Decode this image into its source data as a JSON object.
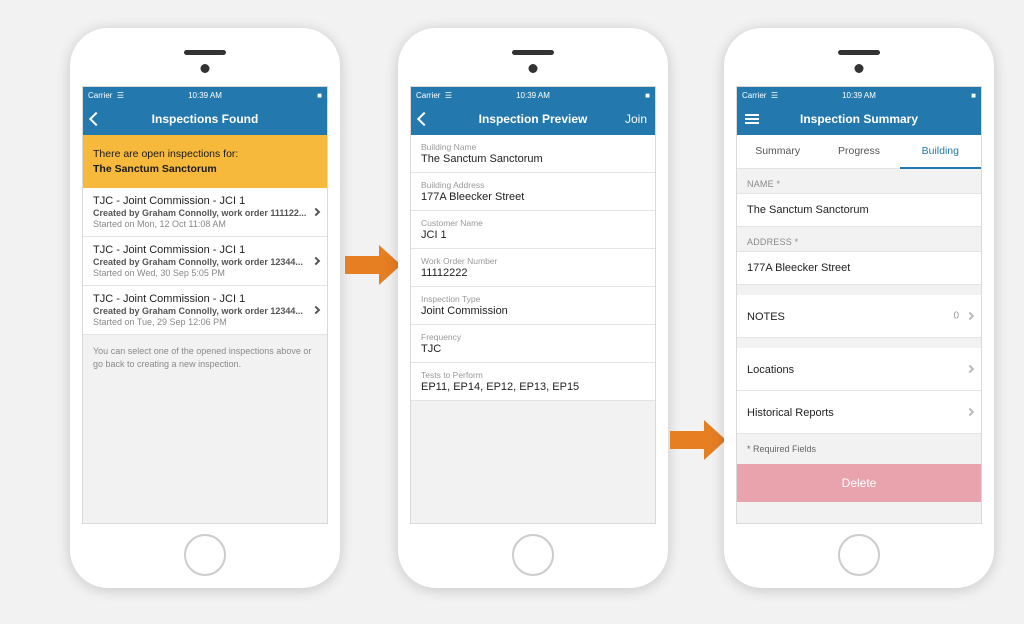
{
  "status": {
    "carrier": "Carrier",
    "wifi": "▴",
    "time": "10:39 AM",
    "battery": "■"
  },
  "phone1": {
    "nav_title": "Inspections Found",
    "banner_line1": "There are open inspections for:",
    "banner_line2": "The Sanctum Sanctorum",
    "items": [
      {
        "title": "TJC - Joint Commission - JCI 1",
        "sub": "Created by Graham Connolly, work order 111122...",
        "started": "Started on Mon, 12 Oct 11:08 AM"
      },
      {
        "title": "TJC - Joint Commission - JCI 1",
        "sub": "Created by Graham Connolly, work order 12344...",
        "started": "Started on Wed, 30 Sep 5:05 PM"
      },
      {
        "title": "TJC - Joint Commission - JCI 1",
        "sub": "Created by Graham Connolly, work order 12344...",
        "started": "Started on Tue, 29 Sep 12:06 PM"
      }
    ],
    "helper": "You can select one of the opened inspections above or go back to creating a new inspection."
  },
  "phone2": {
    "nav_title": "Inspection Preview",
    "join": "Join",
    "fields": [
      {
        "label": "Building Name",
        "value": "The Sanctum Sanctorum"
      },
      {
        "label": "Building Address",
        "value": "177A Bleecker Street"
      },
      {
        "label": "Customer Name",
        "value": "JCI 1"
      },
      {
        "label": "Work Order Number",
        "value": "11112222"
      },
      {
        "label": "Inspection Type",
        "value": "Joint Commission"
      },
      {
        "label": "Frequency",
        "value": "TJC"
      },
      {
        "label": "Tests to Perform",
        "value": "EP11, EP14, EP12, EP13, EP15"
      }
    ]
  },
  "phone3": {
    "nav_title": "Inspection Summary",
    "tabs": {
      "summary": "Summary",
      "progress": "Progress",
      "building": "Building"
    },
    "name_label": "NAME *",
    "name_value": "The Sanctum Sanctorum",
    "address_label": "ADDRESS *",
    "address_value": "177A Bleecker Street",
    "notes_label": "NOTES",
    "notes_count": "0",
    "locations_label": "Locations",
    "historical_label": "Historical Reports",
    "required_note": "* Required Fields",
    "delete_label": "Delete"
  }
}
